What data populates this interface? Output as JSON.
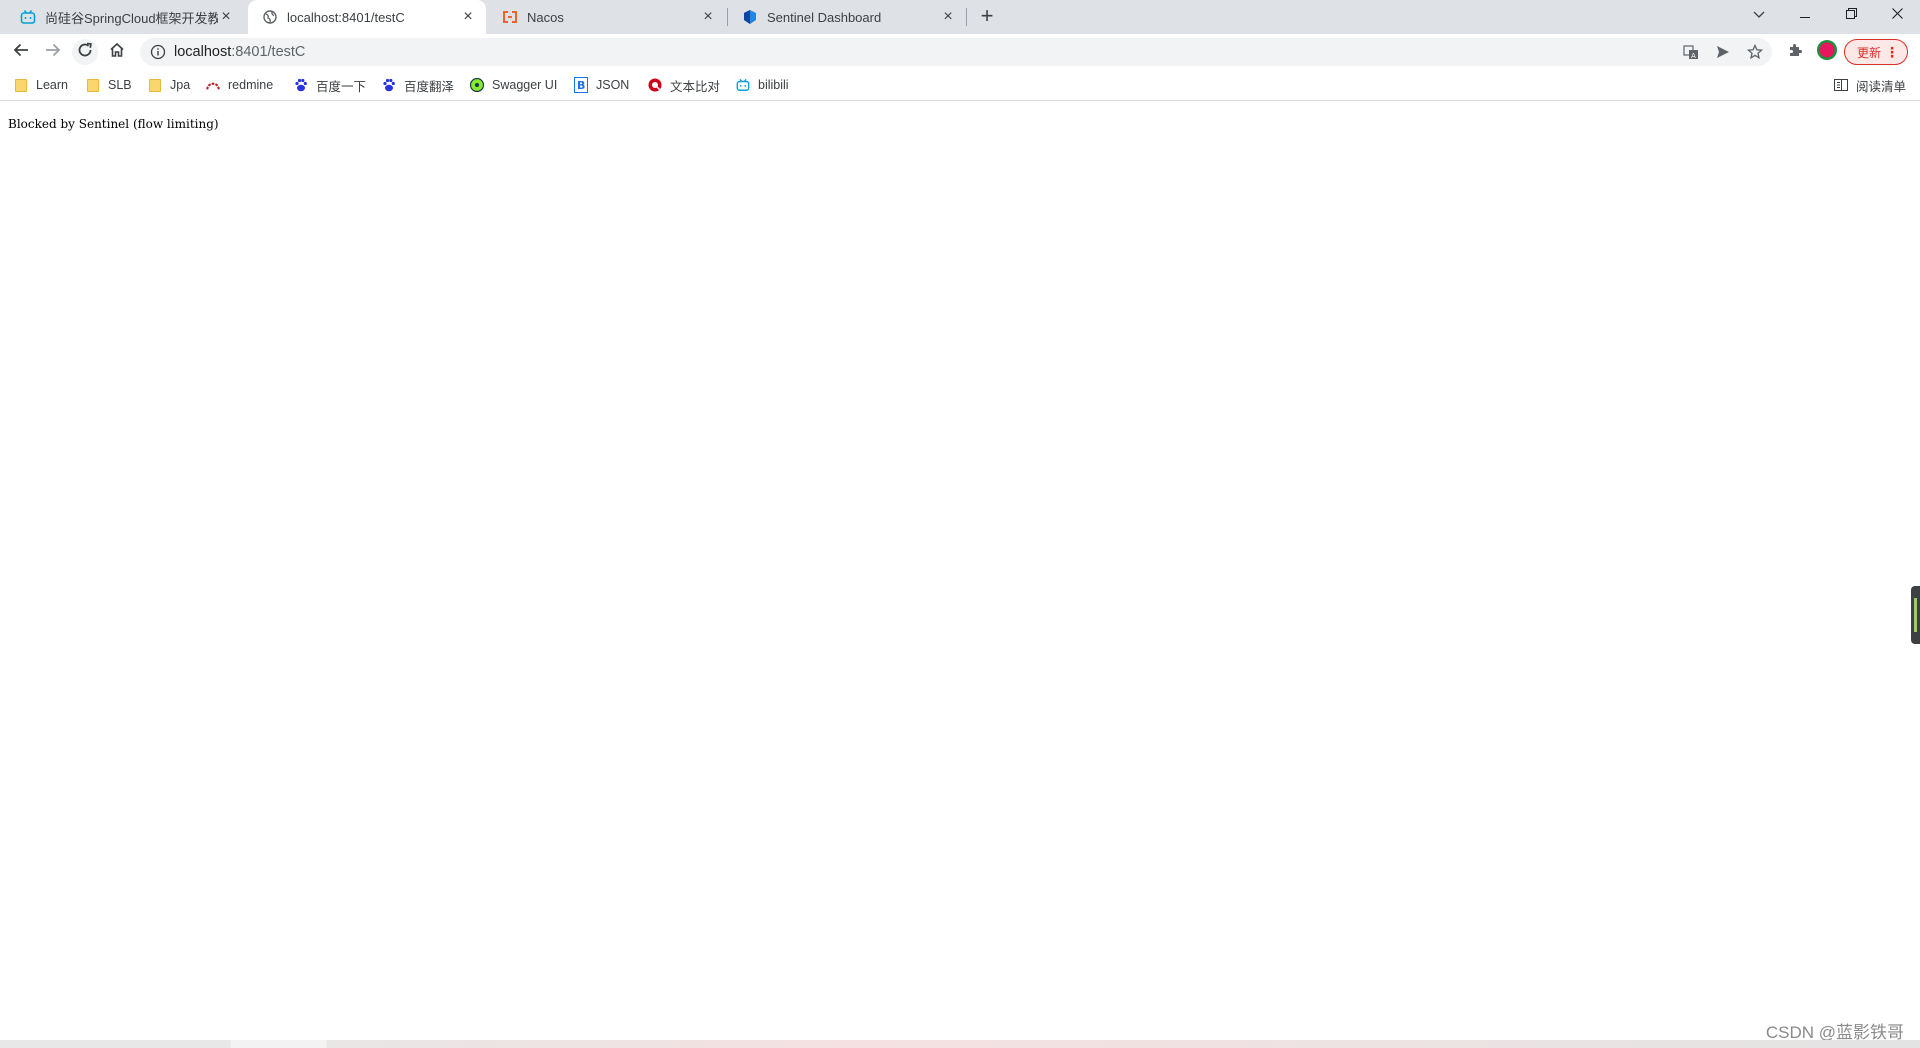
{
  "tabs": [
    {
      "title": "尚硅谷SpringCloud框架开发教程",
      "icon": "bilibili-icon"
    },
    {
      "title": "localhost:8401/testC",
      "icon": "globe-icon"
    },
    {
      "title": "Nacos",
      "icon": "nacos-icon"
    },
    {
      "title": "Sentinel Dashboard",
      "icon": "sentinel-icon"
    }
  ],
  "toolbar": {
    "url_host": "localhost",
    "url_path": ":8401/testC",
    "update_label": "更新"
  },
  "bookmarks": [
    {
      "label": "Learn",
      "icon": "folder-icon"
    },
    {
      "label": "SLB",
      "icon": "folder-icon"
    },
    {
      "label": "Jpa",
      "icon": "folder-icon"
    },
    {
      "label": "redmine",
      "icon": "redmine-icon"
    },
    {
      "label": "百度一下",
      "icon": "baidu-icon"
    },
    {
      "label": "百度翻泽",
      "icon": "baidu-icon"
    },
    {
      "label": "Swagger UI",
      "icon": "swagger-icon"
    },
    {
      "label": "JSON",
      "icon": "json-icon"
    },
    {
      "label": "文本比对",
      "icon": "diff-icon"
    },
    {
      "label": "bilibili",
      "icon": "bilibili-icon"
    }
  ],
  "reading_list_label": "阅读清单",
  "page": {
    "message": "Blocked by Sentinel (flow limiting)"
  },
  "watermark": "CSDN @蓝影铁哥",
  "colors": {
    "tabstrip_bg": "#dee1e6",
    "omnibox_bg": "#f1f3f4",
    "update_red": "#d93025"
  }
}
